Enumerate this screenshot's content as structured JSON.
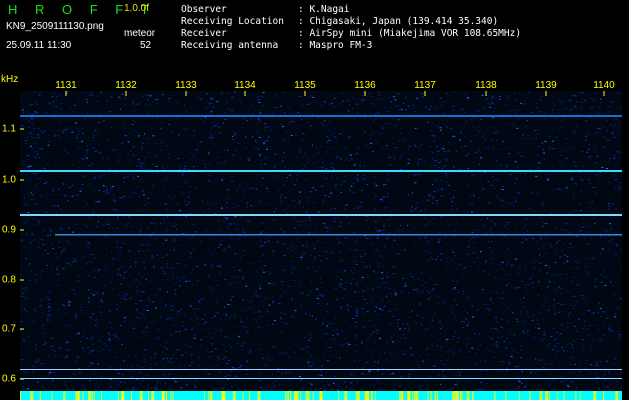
{
  "header": {
    "title": "H R O F F T",
    "version": "1.0.0f",
    "filename": "KN9_2509111130.png",
    "meteor_label": "meteor",
    "datetime": "25.09.11 11:30",
    "meteor_count": "52"
  },
  "info": {
    "observer_label": "Observer",
    "observer_value": ": K.Nagai",
    "location_label": "Receiving Location",
    "location_value": ": Chigasaki, Japan (139.414 35.340)",
    "receiver_label": "Receiver",
    "receiver_value": ": AirSpy mini (Miakejima VOR 108.65MHz)",
    "antenna_label": "Receiving antenna",
    "antenna_value": ": Maspro FM-3"
  },
  "axes": {
    "y_unit": "kHz",
    "x_ticks": [
      "1131",
      "1132",
      "1133",
      "1134",
      "1135",
      "1136",
      "1137",
      "1138",
      "1139",
      "1140"
    ],
    "y_ticks": [
      "1.1",
      "1.0",
      "0.9",
      "0.8",
      "0.7",
      "0.6"
    ]
  },
  "colors": {
    "background": "#000000",
    "title": "#18e018",
    "axis_labels": "#ffff00",
    "noise": "#1a2ec8",
    "trace": "#40d8ff",
    "bottom_band": "#00ffff"
  }
}
